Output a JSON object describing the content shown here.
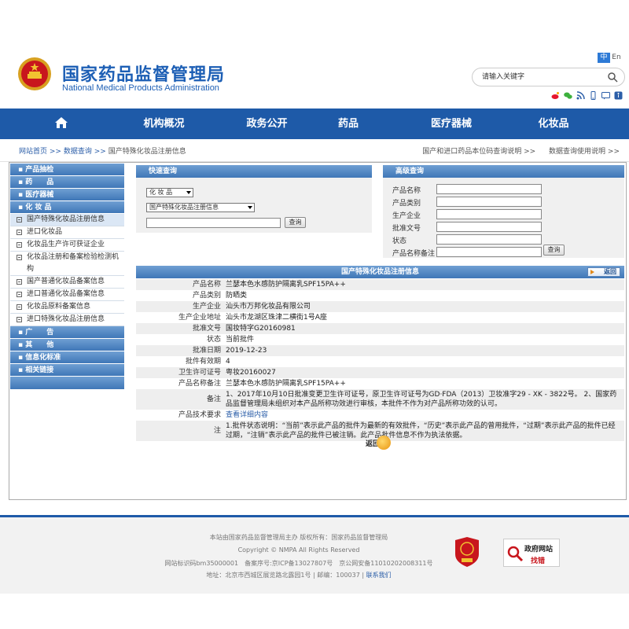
{
  "header": {
    "title_cn": "国家药品监督管理局",
    "title_en": "National Medical Products Administration",
    "lang_zh": "中",
    "lang_en": "En",
    "search_placeholder": "请输入关键字"
  },
  "nav": [
    {
      "label": "",
      "icon": "home-icon"
    },
    {
      "label": "机构概况"
    },
    {
      "label": "政务公开"
    },
    {
      "label": "药品"
    },
    {
      "label": "医疗器械"
    },
    {
      "label": "化妆品"
    }
  ],
  "breadcrumb": {
    "home": "网站首页",
    "sep1": ">>",
    "query": "数据查询",
    "sep2": ">>",
    "current": "国产特殊化妆品注册信息",
    "link1": "国产和进口药品本位码查询说明 >>",
    "link2": "数据查询使用说明 >>"
  },
  "sidebar": [
    {
      "type": "cat",
      "label": "▪ 产品抽检"
    },
    {
      "type": "cat",
      "label": "▪ 药　　品"
    },
    {
      "type": "cat",
      "label": "▪ 医疗器械"
    },
    {
      "type": "cat",
      "label": "▪ 化 妆 品"
    },
    {
      "type": "sub",
      "label": "国产特殊化妆品注册信息",
      "active": true
    },
    {
      "type": "sub",
      "label": "进口化妆品"
    },
    {
      "type": "sub",
      "label": "化妆品生产许可获证企业"
    },
    {
      "type": "sub",
      "label": "化妆品注册和备案检验检测机构"
    },
    {
      "type": "sub",
      "label": "国产普通化妆品备案信息"
    },
    {
      "type": "sub",
      "label": "进口普通化妆品备案信息"
    },
    {
      "type": "sub",
      "label": "化妆品原料备案信息"
    },
    {
      "type": "sub",
      "label": "进口特殊化妆品注册信息"
    },
    {
      "type": "cat",
      "label": "▪ 广　　告"
    },
    {
      "type": "cat",
      "label": "▪ 其　　他"
    },
    {
      "type": "cat",
      "label": "▪ 信息化标准"
    },
    {
      "type": "cat",
      "label": "▪ 相关链接"
    }
  ],
  "quick": {
    "title": "快速查询",
    "select1": "化 妆 品",
    "select2": "国产特殊化妆品注册信息",
    "button": "查询"
  },
  "advanced": {
    "title": "高级查询",
    "fields": [
      "产品名称",
      "产品类别",
      "生产企业",
      "批准文号",
      "状态",
      "产品名称备注"
    ],
    "button": "查询"
  },
  "info": {
    "title": "国产特殊化妆品注册信息",
    "back_label": "返回",
    "rows": [
      {
        "k": "产品名称",
        "v": "兰瑟本色水感防护隔离乳SPF15PA++"
      },
      {
        "k": "产品类别",
        "v": "防晒类"
      },
      {
        "k": "生产企业",
        "v": "汕头市万邦化妆品有限公司"
      },
      {
        "k": "生产企业地址",
        "v": "汕头市龙湖区珠津二横街1号A座"
      },
      {
        "k": "批准文号",
        "v": "国妆特字G20160981"
      },
      {
        "k": "状态",
        "v": "当前批件"
      },
      {
        "k": "批准日期",
        "v": "2019-12-23"
      },
      {
        "k": "批件有效期",
        "v": "4"
      },
      {
        "k": "卫生许可证号",
        "v": "粤妆20160027"
      },
      {
        "k": "产品名称备注",
        "v": "兰瑟本色水感防护隔离乳SPF15PA++"
      },
      {
        "k": "备注",
        "v": "1、2017年10月10日批准变更卫生许可证号，原卫生许可证号为GD·FDA（2013）卫妆准字29 - XK - 3822号。 2、国家药品监督管理局未组织对本产品所称功效进行审核，本批件不作为对产品所称功效的认可。"
      },
      {
        "k": "产品技术要求",
        "v": "查看详细内容",
        "link": true
      },
      {
        "k": "注",
        "v": "1.批件状态说明：“当前”表示此产品的批件为最新的有效批件，“历史”表示此产品的曾用批件，“过期”表示此产品的批件已经过期，“注销”表示此产品的批件已被注销。此产品批件信息不作为执法依据。"
      }
    ],
    "back_button": "返回"
  },
  "footer": {
    "line1": "本站由国家药品监督管理局主办 版权所有：国家药品监督管理局",
    "line2": "Copyright © NMPA All Rights Reserved",
    "line3": "网站标识码bm35000001　备案序号:京ICP备13027807号　京公网安备11010202008311号",
    "line4": "地址：北京市西城区展览路北露园1号 | 邮编：100037 |",
    "contact": "联系我们",
    "gov_t1": "政府网站",
    "gov_t2": "找错",
    "party_label": "党政机关"
  }
}
